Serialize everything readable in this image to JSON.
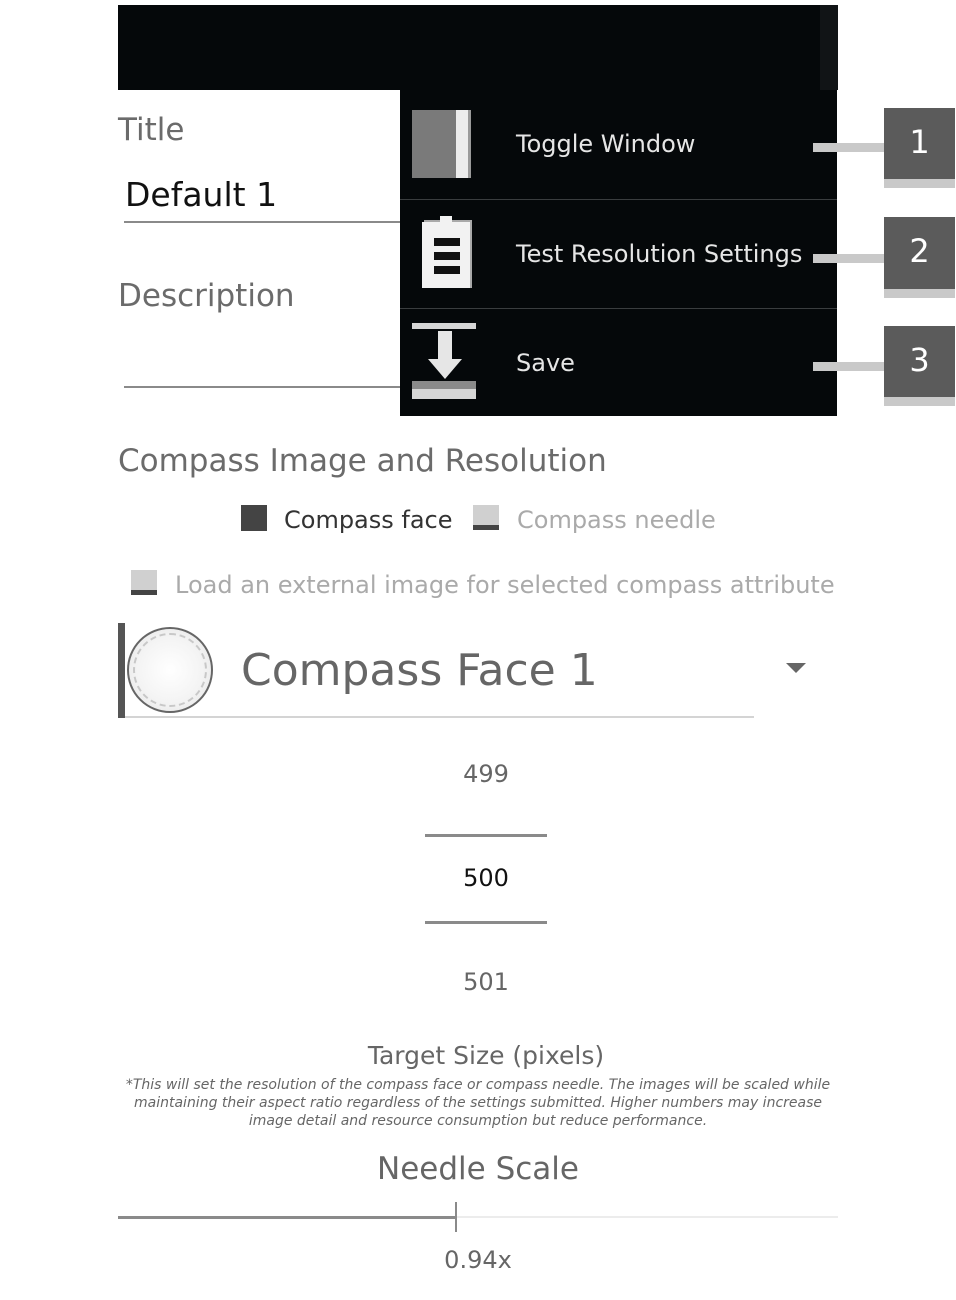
{
  "form": {
    "title_label": "Title",
    "title_value": "Default 1",
    "description_label": "Description",
    "description_value": ""
  },
  "menu": {
    "items": [
      {
        "label": "Toggle Window",
        "icon": "window-toggle-icon"
      },
      {
        "label": "Test Resolution Settings",
        "icon": "clipboard-icon"
      },
      {
        "label": "Save",
        "icon": "download-save-icon"
      }
    ]
  },
  "callouts": [
    "1",
    "2",
    "3"
  ],
  "compass": {
    "section_title": "Compass Image and Resolution",
    "options": [
      {
        "label": "Compass face",
        "selected": true
      },
      {
        "label": "Compass needle",
        "selected": false
      }
    ],
    "external_image_label": "Load an external image for selected compass attribute",
    "external_image_checked": false,
    "selected_face": "Compass Face 1"
  },
  "resolution": {
    "prev": "499",
    "current": "500",
    "next": "501",
    "label": "Target Size (pixels)",
    "note": "*This will set the resolution of the compass face or compass needle. The images will be scaled while maintaining their aspect ratio regardless of the settings submitted. Higher numbers may increase image detail and resource consumption but reduce performance."
  },
  "needle": {
    "label": "Needle Scale",
    "value_text": "0.94x",
    "slider_fraction": 0.47
  },
  "colors": {
    "menu_bg": "#05080a",
    "callout_bg": "#5b5b5b",
    "callout_line": "#c9c9c9"
  }
}
